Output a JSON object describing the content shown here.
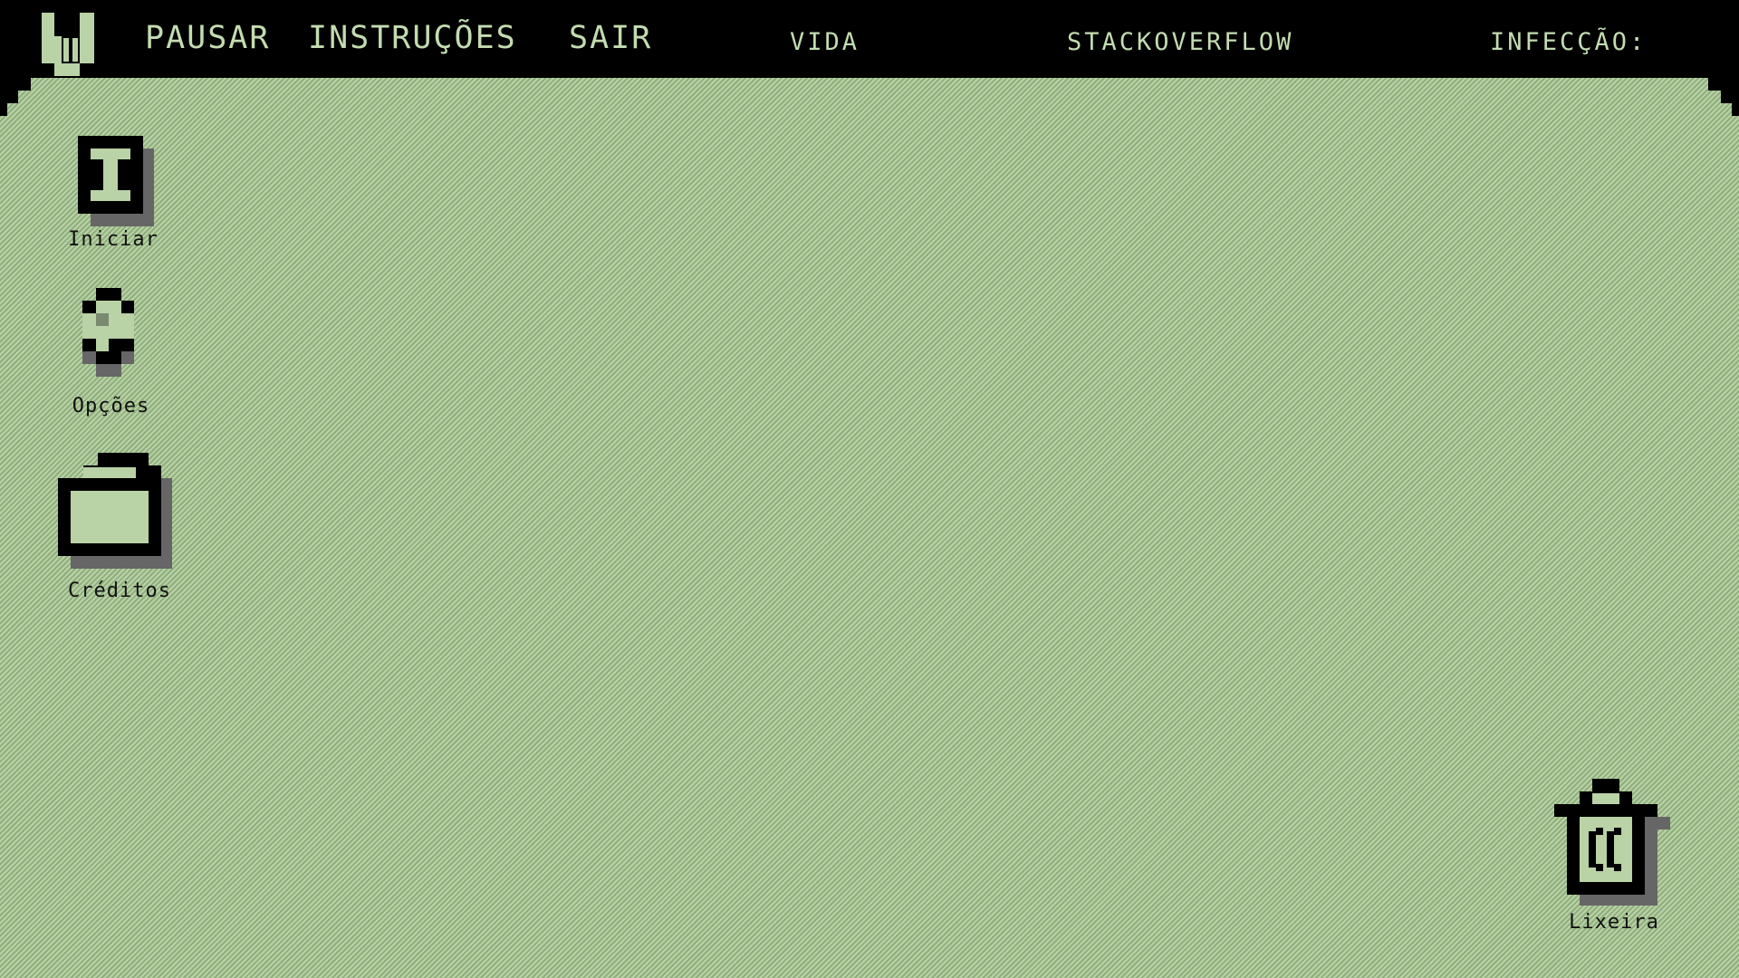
{
  "menubar": {
    "logo_icon": "pixel-hand-logo-icon",
    "items": [
      {
        "label": "PAUSAR"
      },
      {
        "label": "INSTRUÇÕES"
      },
      {
        "label": "SAIR"
      }
    ],
    "status": {
      "vida_label": "VIDA",
      "stack_label": "STACKOVERFLOW",
      "infeccao_label": "INFECÇÃO:"
    }
  },
  "desktop": {
    "icons": [
      {
        "label": "Iniciar",
        "icon": "i-beam-icon"
      },
      {
        "label": "Opções",
        "icon": "ring-icon"
      },
      {
        "label": "Créditos",
        "icon": "folder-icon"
      },
      {
        "label": "Lixeira",
        "icon": "trash-icon"
      }
    ]
  },
  "colors": {
    "menubar_bg": "#000000",
    "menu_text": "#c3dcb0",
    "desktop_light": "#b9d2a6",
    "desktop_dark": "#8fae7d",
    "icon_shadow": "#666666"
  }
}
